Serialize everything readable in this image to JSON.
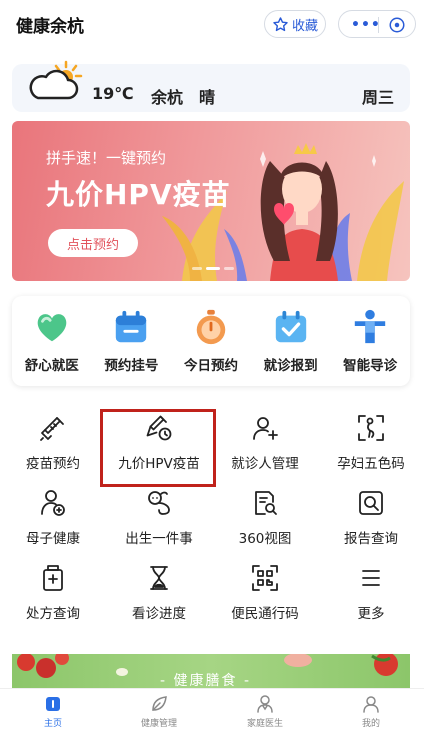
{
  "header": {
    "title": "健康余杭",
    "favorite_label": "收藏",
    "more_label": "•••"
  },
  "weather": {
    "temperature": "19℃",
    "city": "余杭",
    "condition": "晴",
    "weekday": "周三"
  },
  "banner": {
    "subtitle": "拼手速！一键预约",
    "title": "九价HPV疫苗",
    "cta": "点击预约"
  },
  "quick_actions": [
    {
      "label": "舒心就医",
      "icon": "heart-shield-icon"
    },
    {
      "label": "预约挂号",
      "icon": "calendar-icon"
    },
    {
      "label": "今日预约",
      "icon": "stopwatch-icon"
    },
    {
      "label": "就诊报到",
      "icon": "checkin-icon"
    },
    {
      "label": "智能导诊",
      "icon": "person-guide-icon"
    }
  ],
  "services": [
    {
      "label": "疫苗预约",
      "icon": "syringe-icon"
    },
    {
      "label": "九价HPV疫苗",
      "icon": "vaccine-clock-icon"
    },
    {
      "label": "就诊人管理",
      "icon": "person-add-icon"
    },
    {
      "label": "孕妇五色码",
      "icon": "pregnant-scan-icon"
    },
    {
      "label": "母子健康",
      "icon": "mother-child-icon"
    },
    {
      "label": "出生一件事",
      "icon": "baby-icon"
    },
    {
      "label": "360视图",
      "icon": "document-view-icon"
    },
    {
      "label": "报告查询",
      "icon": "report-search-icon"
    },
    {
      "label": "处方查询",
      "icon": "prescription-icon"
    },
    {
      "label": "看诊进度",
      "icon": "hourglass-icon"
    },
    {
      "label": "便民通行码",
      "icon": "qr-code-icon"
    },
    {
      "label": "更多",
      "icon": "menu-icon"
    }
  ],
  "food_banner": {
    "text": "- 健康膳食 -"
  },
  "tabbar": [
    {
      "label": "主页",
      "icon": "home-icon",
      "active": true
    },
    {
      "label": "健康管理",
      "icon": "leaf-icon",
      "active": false
    },
    {
      "label": "家庭医生",
      "icon": "doctor-icon",
      "active": false
    },
    {
      "label": "我的",
      "icon": "profile-icon",
      "active": false
    }
  ],
  "colors": {
    "brand_blue": "#2a5bd7",
    "highlight_red": "#c0221b",
    "banner_pink": "#e9757b",
    "quick_green": "#4cc68a"
  }
}
